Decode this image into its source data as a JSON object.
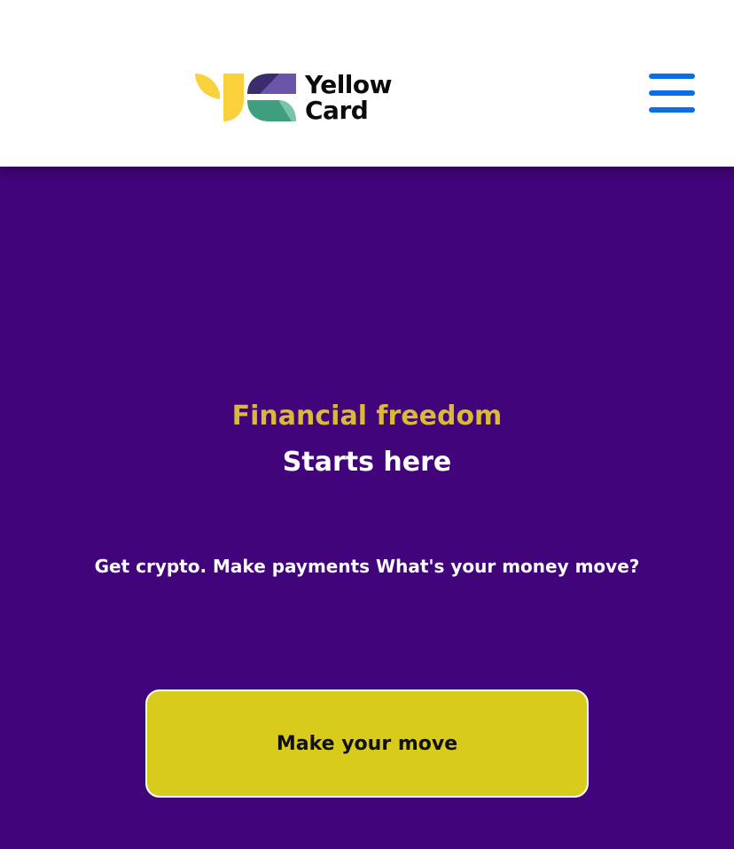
{
  "header": {
    "logo": {
      "icon": "yellow-card-logo-mark",
      "text_line1": "Yellow",
      "text_line2": "Card",
      "colors": {
        "leaf": "#f9d13d",
        "purple_dark": "#3b2c6e",
        "purple_light": "#6b55a8",
        "green_dark": "#3e9f7e",
        "green_light": "#7cc4a7"
      }
    },
    "menu": {
      "icon": "hamburger-menu-icon",
      "color": "#0a6ee8"
    }
  },
  "hero": {
    "background_color": "#42047a",
    "title": "Financial freedom",
    "title_color": "#d9b83a",
    "subtitle": "Starts here",
    "tagline": "Get crypto. Make payments What's your money move?",
    "cta_label": "Make your move",
    "cta_color": "#d9cb1c"
  }
}
